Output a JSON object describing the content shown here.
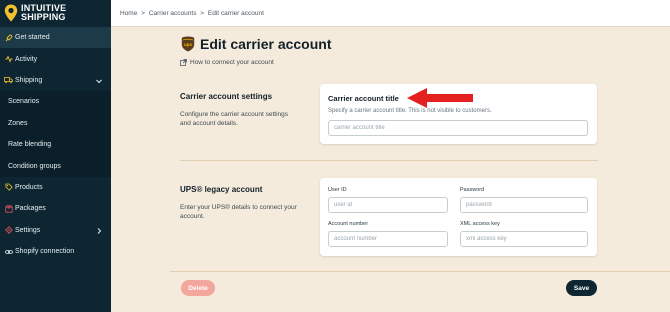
{
  "brand": {
    "line1": "INTUITIVE",
    "line2": "SHIPPING",
    "accent": "#f2c12e"
  },
  "sidebar": {
    "items": [
      {
        "label": "Get started",
        "icon": "rocket-icon",
        "active": true
      },
      {
        "label": "Activity",
        "icon": "activity-icon"
      },
      {
        "label": "Shipping",
        "icon": "truck-icon",
        "expanded": true
      },
      {
        "label": "Scenarios",
        "sub": true
      },
      {
        "label": "Zones",
        "sub": true
      },
      {
        "label": "Rate blending",
        "sub": true
      },
      {
        "label": "Condition groups",
        "sub": true
      },
      {
        "label": "Products",
        "icon": "tag-icon"
      },
      {
        "label": "Packages",
        "icon": "package-icon"
      },
      {
        "label": "Settings",
        "icon": "gear-icon"
      },
      {
        "label": "Shopify connection",
        "icon": "link-icon"
      }
    ]
  },
  "breadcrumb": {
    "home": "Home",
    "sep": ">",
    "carriers": "Carrier accounts",
    "current": "Edit carrier account"
  },
  "page": {
    "title": "Edit carrier account",
    "howto": "How to connect your account"
  },
  "settings_section": {
    "title": "Carrier account settings",
    "desc": "Configure the carrier account settings and account details.",
    "card_title": "Carrier account title",
    "card_hint": "Specify a carrier account title. This is not visible to customers.",
    "input_placeholder": "carrier account title"
  },
  "ups_section": {
    "title": "UPS® legacy account",
    "desc": "Enter your UPS® details to connect your account.",
    "user_id_label": "User ID",
    "user_id_placeholder": "user id",
    "password_label": "Password",
    "password_placeholder": "password",
    "account_label": "Account number",
    "account_placeholder": "account number",
    "xml_label": "XML access key",
    "xml_placeholder": "xml access key"
  },
  "buttons": {
    "delete": "Delete",
    "save": "Save"
  },
  "colors": {
    "sidebar_bg": "#0d2632",
    "page_bg": "#f5ebdc",
    "arrow": "#e52020",
    "delete_bg": "#f3a69d",
    "save_bg": "#0d2632",
    "ups_brown": "#5b3d1e",
    "ups_gold": "#f5b300"
  }
}
